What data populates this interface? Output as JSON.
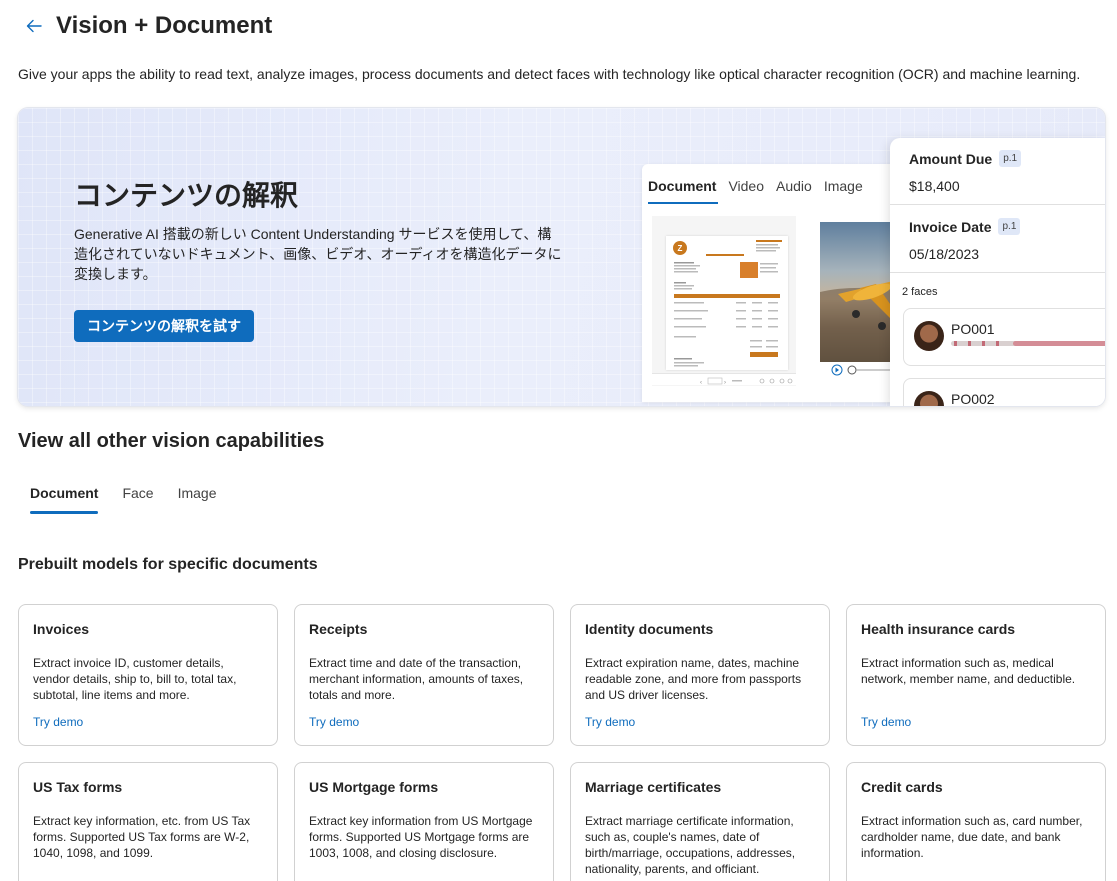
{
  "header": {
    "title": "Vision + Document",
    "back_label": "Back"
  },
  "description": "Give your apps the ability to read text, analyze images, process documents and detect faces with technology like optical character recognition (OCR) and machine learning.",
  "banner": {
    "title": "コンテンツの解釈",
    "description": "Generative AI 搭載の新しい Content Understanding サービスを使用して、構造化されていないドキュメント、画像、ビデオ、オーディオを構造化データに変換します。",
    "button_label": "コンテンツの解釈を試す",
    "preview_tabs": [
      "Document",
      "Video",
      "Audio",
      "Image"
    ],
    "fields": [
      {
        "label": "Amount Due",
        "badge": "p.1",
        "value": "$18,400"
      },
      {
        "label": "Invoice Date",
        "badge": "p.1",
        "value": "05/18/2023"
      }
    ],
    "faces_count": "2 faces",
    "faces": [
      "PO001",
      "PO002"
    ]
  },
  "section_title": "View all other vision capabilities",
  "tabs": [
    "Document",
    "Face",
    "Image"
  ],
  "active_tab": "Document",
  "subsection_title": "Prebuilt models for specific documents",
  "cards": [
    {
      "title": "Invoices",
      "description": "Extract invoice ID, customer details, vendor details, ship to, bill to, total tax, subtotal, line items and more.",
      "link": "Try demo"
    },
    {
      "title": "Receipts",
      "description": "Extract time and date of the transaction, merchant information, amounts of taxes, totals and more.",
      "link": "Try demo"
    },
    {
      "title": "Identity documents",
      "description": "Extract expiration name, dates, machine readable zone, and more from passports and US driver licenses.",
      "link": "Try demo"
    },
    {
      "title": "Health insurance cards",
      "description": "Extract information such as, medical network, member name, and deductible.",
      "link": "Try demo"
    },
    {
      "title": "US Tax forms",
      "description": "Extract key information, etc. from US Tax forms. Supported US Tax forms are W-2, 1040, 1098, and 1099.",
      "link": ""
    },
    {
      "title": "US Mortgage forms",
      "description": "Extract key information from US Mortgage forms. Supported US Mortgage forms are 1003, 1008, and closing disclosure.",
      "link": ""
    },
    {
      "title": "Marriage certificates",
      "description": "Extract marriage certificate information, such as, couple's names, date of birth/marriage, occupations, addresses, nationality, parents, and officiant.",
      "link": ""
    },
    {
      "title": "Credit cards",
      "description": "Extract information such as, card number, cardholder name, due date, and bank information.",
      "link": ""
    }
  ],
  "colors": {
    "accent": "#0f6cbd",
    "text": "#242424",
    "border": "#d1d1d1"
  }
}
